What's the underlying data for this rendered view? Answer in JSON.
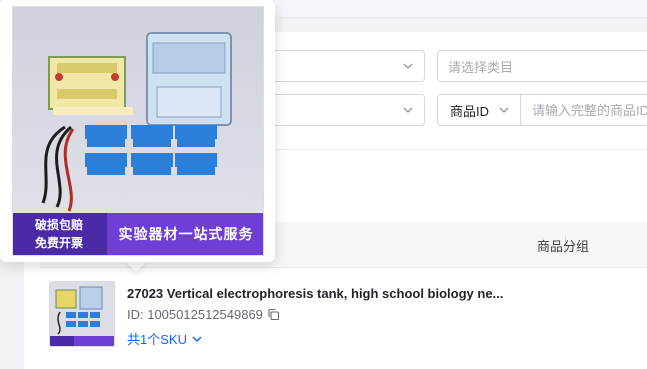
{
  "filters": {
    "category_placeholder": "请选择类目",
    "search_type_label": "商品ID",
    "search_placeholder": "请输入完整的商品ID"
  },
  "table": {
    "columns": [
      "商品分组"
    ]
  },
  "product": {
    "title": "27023 Vertical electrophoresis tank, high school biology ne...",
    "id_text": "ID: 1005012512549869",
    "sku_text": "共1个SKU"
  },
  "popover": {
    "banner_left_line1": "破损包赔",
    "banner_left_line2": "免费开票",
    "banner_right": "实验器材一站式服务"
  },
  "colors": {
    "accent": "#1664ff",
    "banner_dark": "#4b2aa8",
    "banner_light": "#6f3ed6"
  }
}
